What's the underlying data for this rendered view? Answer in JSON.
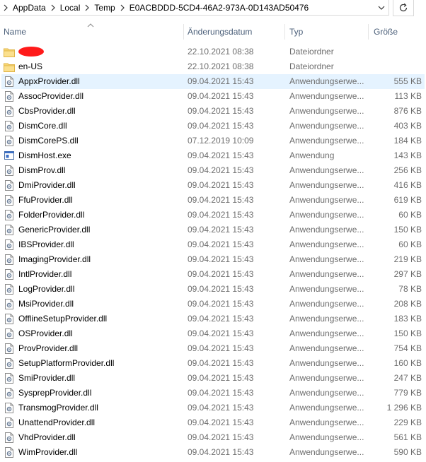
{
  "window": {
    "title": "E0ACBDDD-5CD4-46A2-973A-0D143AD50476"
  },
  "addressbar": {
    "crumbs": [
      "AppData",
      "Local",
      "Temp",
      "E0ACBDDD-5CD4-46A2-973A-0D143AD50476"
    ]
  },
  "columns": {
    "name": "Name",
    "date": "Änderungsdatum",
    "type": "Typ",
    "size": "Größe"
  },
  "files": [
    {
      "name": "",
      "redacted": true,
      "date": "22.10.2021 08:38",
      "type": "Dateiordner",
      "size": "",
      "icon": "folder-icon"
    },
    {
      "name": "en-US",
      "date": "22.10.2021 08:38",
      "type": "Dateiordner",
      "size": "",
      "icon": "folder-icon"
    },
    {
      "name": "AppxProvider.dll",
      "date": "09.04.2021 15:43",
      "type": "Anwendungserwe...",
      "size": "555 KB",
      "icon": "dll-icon",
      "selected": true
    },
    {
      "name": "AssocProvider.dll",
      "date": "09.04.2021 15:43",
      "type": "Anwendungserwe...",
      "size": "113 KB",
      "icon": "dll-icon"
    },
    {
      "name": "CbsProvider.dll",
      "date": "09.04.2021 15:43",
      "type": "Anwendungserwe...",
      "size": "876 KB",
      "icon": "dll-icon"
    },
    {
      "name": "DismCore.dll",
      "date": "09.04.2021 15:43",
      "type": "Anwendungserwe...",
      "size": "403 KB",
      "icon": "dll-icon"
    },
    {
      "name": "DismCorePS.dll",
      "date": "07.12.2019 10:09",
      "type": "Anwendungserwe...",
      "size": "184 KB",
      "icon": "dll-icon"
    },
    {
      "name": "DismHost.exe",
      "date": "09.04.2021 15:43",
      "type": "Anwendung",
      "size": "143 KB",
      "icon": "exe-icon"
    },
    {
      "name": "DismProv.dll",
      "date": "09.04.2021 15:43",
      "type": "Anwendungserwe...",
      "size": "256 KB",
      "icon": "dll-icon"
    },
    {
      "name": "DmiProvider.dll",
      "date": "09.04.2021 15:43",
      "type": "Anwendungserwe...",
      "size": "416 KB",
      "icon": "dll-icon"
    },
    {
      "name": "FfuProvider.dll",
      "date": "09.04.2021 15:43",
      "type": "Anwendungserwe...",
      "size": "619 KB",
      "icon": "dll-icon"
    },
    {
      "name": "FolderProvider.dll",
      "date": "09.04.2021 15:43",
      "type": "Anwendungserwe...",
      "size": "60 KB",
      "icon": "dll-icon"
    },
    {
      "name": "GenericProvider.dll",
      "date": "09.04.2021 15:43",
      "type": "Anwendungserwe...",
      "size": "150 KB",
      "icon": "dll-icon"
    },
    {
      "name": "IBSProvider.dll",
      "date": "09.04.2021 15:43",
      "type": "Anwendungserwe...",
      "size": "60 KB",
      "icon": "dll-icon"
    },
    {
      "name": "ImagingProvider.dll",
      "date": "09.04.2021 15:43",
      "type": "Anwendungserwe...",
      "size": "219 KB",
      "icon": "dll-icon"
    },
    {
      "name": "IntlProvider.dll",
      "date": "09.04.2021 15:43",
      "type": "Anwendungserwe...",
      "size": "297 KB",
      "icon": "dll-icon"
    },
    {
      "name": "LogProvider.dll",
      "date": "09.04.2021 15:43",
      "type": "Anwendungserwe...",
      "size": "78 KB",
      "icon": "dll-icon"
    },
    {
      "name": "MsiProvider.dll",
      "date": "09.04.2021 15:43",
      "type": "Anwendungserwe...",
      "size": "208 KB",
      "icon": "dll-icon"
    },
    {
      "name": "OfflineSetupProvider.dll",
      "date": "09.04.2021 15:43",
      "type": "Anwendungserwe...",
      "size": "183 KB",
      "icon": "dll-icon"
    },
    {
      "name": "OSProvider.dll",
      "date": "09.04.2021 15:43",
      "type": "Anwendungserwe...",
      "size": "150 KB",
      "icon": "dll-icon"
    },
    {
      "name": "ProvProvider.dll",
      "date": "09.04.2021 15:43",
      "type": "Anwendungserwe...",
      "size": "754 KB",
      "icon": "dll-icon"
    },
    {
      "name": "SetupPlatformProvider.dll",
      "date": "09.04.2021 15:43",
      "type": "Anwendungserwe...",
      "size": "160 KB",
      "icon": "dll-icon"
    },
    {
      "name": "SmiProvider.dll",
      "date": "09.04.2021 15:43",
      "type": "Anwendungserwe...",
      "size": "247 KB",
      "icon": "dll-icon"
    },
    {
      "name": "SysprepProvider.dll",
      "date": "09.04.2021 15:43",
      "type": "Anwendungserwe...",
      "size": "779 KB",
      "icon": "dll-icon"
    },
    {
      "name": "TransmogProvider.dll",
      "date": "09.04.2021 15:43",
      "type": "Anwendungserwe...",
      "size": "1 296 KB",
      "icon": "dll-icon"
    },
    {
      "name": "UnattendProvider.dll",
      "date": "09.04.2021 15:43",
      "type": "Anwendungserwe...",
      "size": "229 KB",
      "icon": "dll-icon"
    },
    {
      "name": "VhdProvider.dll",
      "date": "09.04.2021 15:43",
      "type": "Anwendungserwe...",
      "size": "561 KB",
      "icon": "dll-icon"
    },
    {
      "name": "WimProvider.dll",
      "date": "09.04.2021 15:43",
      "type": "Anwendungserwe...",
      "size": "590 KB",
      "icon": "dll-icon"
    }
  ],
  "colors": {
    "selection": "#e5f3ff",
    "header_text": "#4c607a",
    "folder": "#f8d775",
    "secondary_text": "#6d6d6d"
  }
}
